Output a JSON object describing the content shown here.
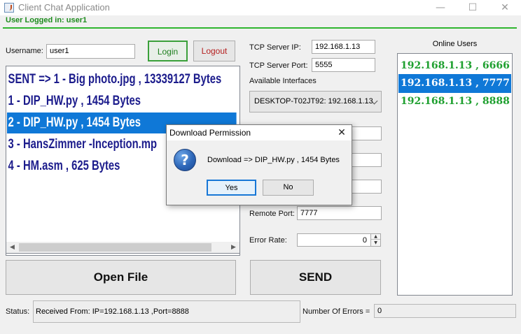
{
  "window": {
    "title": "Client Chat Application",
    "minimize": "—",
    "maximize": "☐",
    "close": "✕"
  },
  "session": {
    "logged_in_text": "User Logged in: user1"
  },
  "login": {
    "username_label": "Username:",
    "username_value": "user1",
    "login_label": "Login",
    "logout_label": "Logout"
  },
  "files": {
    "items": [
      "SENT => 1 - Big photo.jpg , 13339127 Bytes",
      "1 - DIP_HW.py , 1454 Bytes",
      "2 - DIP_HW.py , 1454 Bytes",
      "3 - HansZimmer -Inception.mp",
      "4 - HM.asm , 625 Bytes"
    ],
    "selected_index": 2
  },
  "server": {
    "ip_label": "TCP Server IP:",
    "ip_value": "192.168.1.13",
    "port_label": "TCP Server Port:",
    "port_value": "5555",
    "interfaces_label": "Available Interfaces",
    "interface_value": "DESKTOP-T02JT92: 192.168.1.13",
    "remote_port_label": "Remote Port:",
    "remote_port_value": "7777",
    "error_rate_label": "Error Rate:",
    "error_rate_value": "0"
  },
  "buttons": {
    "open_file": "Open File",
    "send": "SEND"
  },
  "online": {
    "title": "Online Users",
    "users": [
      "192.168.1.13 , 6666",
      "192.168.1.13 , 7777",
      "192.168.1.13 , 8888"
    ],
    "selected_index": 1
  },
  "status": {
    "label": "Status:",
    "value": "Received From: IP=192.168.1.13 ,Port=8888",
    "errors_label": "Number Of Errors =",
    "errors_value": "0"
  },
  "dialog": {
    "title": "Download Permission",
    "close": "✕",
    "icon": "question-icon",
    "message": "Download => DIP_HW.py , 1454 Bytes",
    "yes": "Yes",
    "no": "No"
  },
  "colors": {
    "accent_green": "#2fb52f",
    "selection_blue": "#0f78d7",
    "file_text_navy": "#1c1c8c",
    "user_text_green": "#1fa030",
    "logout_red": "#b52020"
  }
}
